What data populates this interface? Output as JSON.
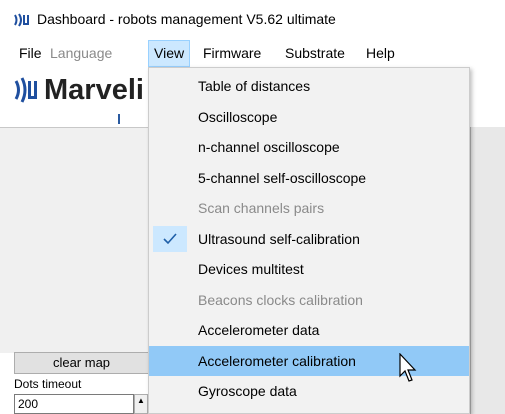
{
  "window": {
    "title": "Dashboard - robots management  V5.62  ultimate"
  },
  "menubar": {
    "items": [
      {
        "label": "File",
        "state": "normal"
      },
      {
        "label": "Language",
        "state": "disabled"
      },
      {
        "label": "View",
        "state": "active"
      },
      {
        "label": "Firmware",
        "state": "normal"
      },
      {
        "label": "Substrate",
        "state": "normal"
      },
      {
        "label": "Help",
        "state": "normal"
      }
    ]
  },
  "logo": {
    "text": "Marveli"
  },
  "view_menu": {
    "items": [
      {
        "label": "Table of distances",
        "enabled": true,
        "checked": false,
        "highlighted": false
      },
      {
        "label": "Oscilloscope",
        "enabled": true,
        "checked": false,
        "highlighted": false
      },
      {
        "label": "n-channel oscilloscope",
        "enabled": true,
        "checked": false,
        "highlighted": false
      },
      {
        "label": "5-channel self-oscilloscope",
        "enabled": true,
        "checked": false,
        "highlighted": false
      },
      {
        "label": "Scan channels pairs",
        "enabled": false,
        "checked": false,
        "highlighted": false
      },
      {
        "label": "Ultrasound self-calibration",
        "enabled": true,
        "checked": true,
        "highlighted": false
      },
      {
        "label": "Devices multitest",
        "enabled": true,
        "checked": false,
        "highlighted": false
      },
      {
        "label": "Beacons clocks calibration",
        "enabled": false,
        "checked": false,
        "highlighted": false
      },
      {
        "label": "Accelerometer data",
        "enabled": true,
        "checked": false,
        "highlighted": false
      },
      {
        "label": "Accelerometer calibration",
        "enabled": true,
        "checked": false,
        "highlighted": true
      },
      {
        "label": "Gyroscope data",
        "enabled": true,
        "checked": false,
        "highlighted": false
      }
    ]
  },
  "controls": {
    "clear_map_label": "clear map",
    "dots_timeout_label": "Dots timeout",
    "dots_timeout_value": "200"
  },
  "colors": {
    "menu_active_bg": "#cce8ff",
    "menu_highlight_bg": "#91c9f7",
    "check_bg": "#cce8ff",
    "check_color": "#1f5fa8",
    "logo_blue": "#1f4f9f"
  }
}
